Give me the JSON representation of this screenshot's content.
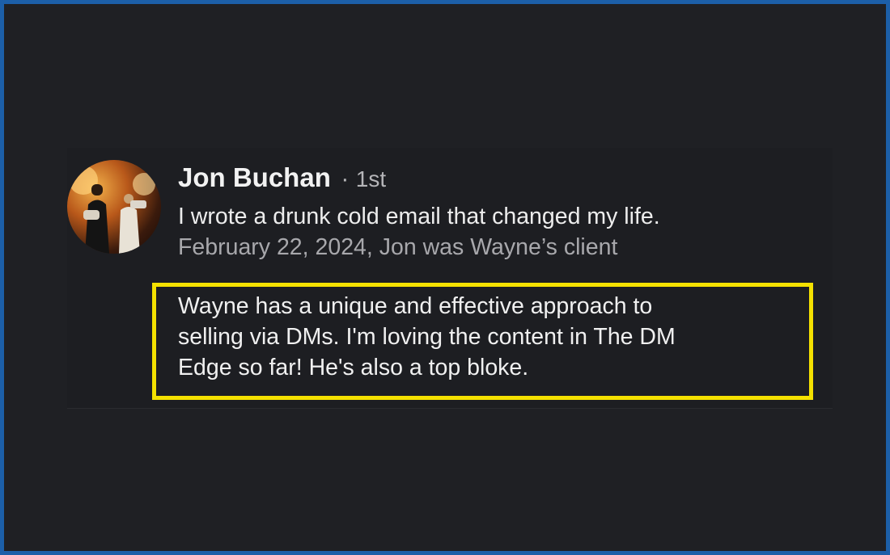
{
  "recommendation": {
    "author_name": "Jon Buchan",
    "separator": "·",
    "connection_degree": "1st",
    "headline": "I wrote a drunk cold email that changed my life.",
    "meta": "February 22, 2024, Jon was Wayne’s client",
    "body_lines": [
      "Wayne has a unique and effective approach to",
      "selling via DMs. I'm loving the content in The DM",
      "Edge so far! He's also a top bloke."
    ]
  },
  "colors": {
    "frame_border": "#1c5fa8",
    "background": "#1f2024",
    "highlight_border": "#f4e100"
  },
  "icons": {
    "avatar": "profile-photo"
  }
}
